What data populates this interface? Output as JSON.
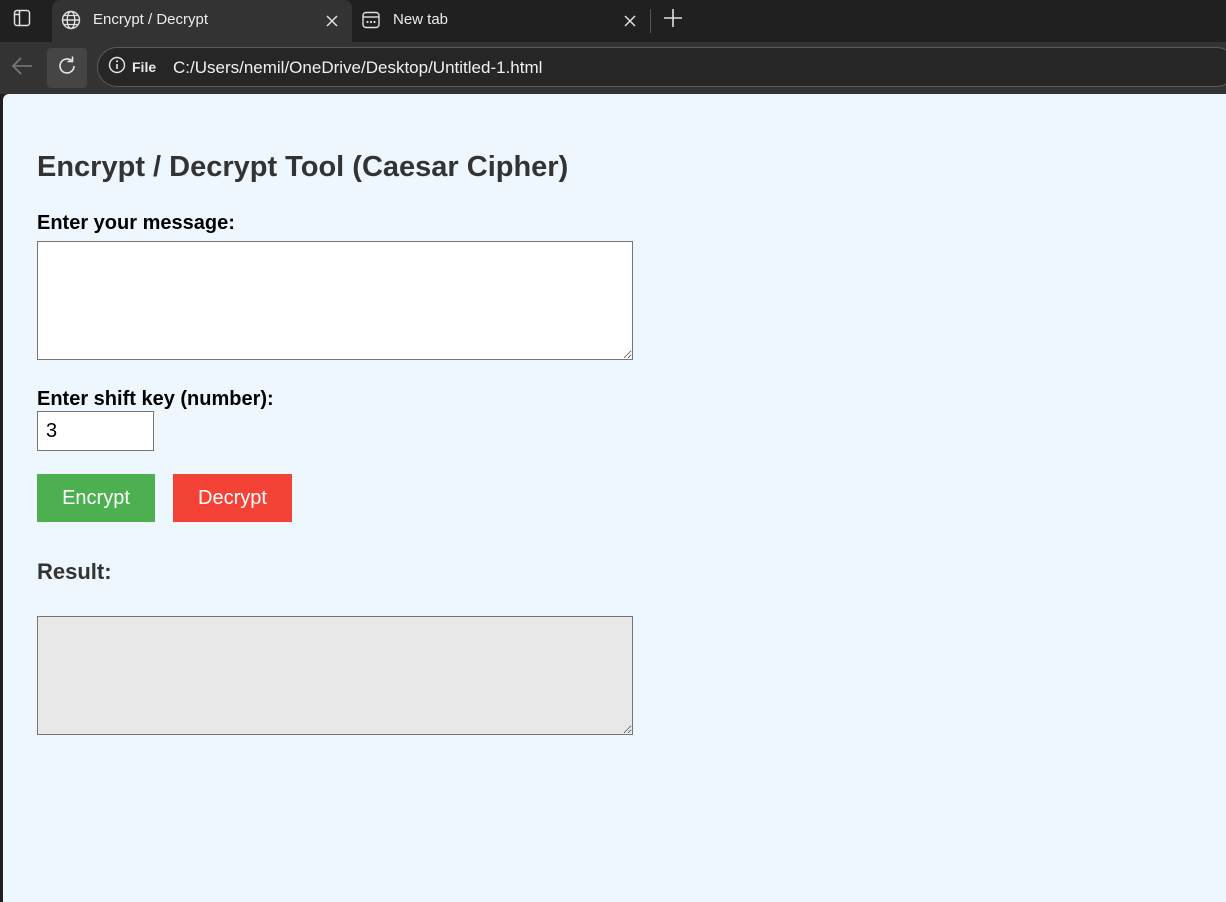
{
  "browser": {
    "tabs": [
      {
        "title": "Encrypt / Decrypt",
        "icon": "globe-icon",
        "active": true
      },
      {
        "title": "New tab",
        "icon": "new-tab-page-icon",
        "active": false
      }
    ],
    "address": {
      "security_label": "File",
      "url": "C:/Users/nemil/OneDrive/Desktop/Untitled-1.html"
    }
  },
  "page": {
    "title": "Encrypt / Decrypt Tool (Caesar Cipher)",
    "message_label": "Enter your message:",
    "message_value": "",
    "shift_label": "Enter shift key (number):",
    "shift_value": "3",
    "encrypt_label": "Encrypt",
    "decrypt_label": "Decrypt",
    "result_label": "Result:",
    "result_value": ""
  },
  "colors": {
    "page_background": "#eef7fe",
    "encrypt_button": "#4caf50",
    "decrypt_button": "#f44336",
    "result_background": "#e8e8e8",
    "heading_text": "#333333"
  }
}
